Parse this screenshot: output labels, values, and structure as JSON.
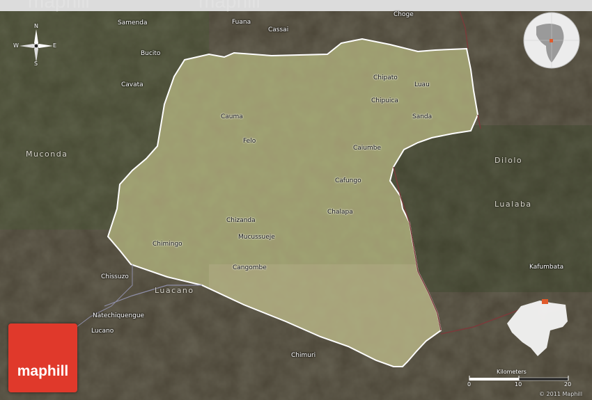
{
  "watermarks": [
    "maphill",
    "maphill"
  ],
  "logo_text": "maphill",
  "colors": {
    "accent": "#e0392b",
    "highlight": "#e05a2b",
    "border": "#ffffff"
  },
  "compass": {
    "n": "N",
    "s": "S",
    "e": "E",
    "w": "W"
  },
  "places": [
    {
      "name": "Samenda",
      "inner": false
    },
    {
      "name": "Fuana",
      "inner": false
    },
    {
      "name": "Cassai",
      "inner": false
    },
    {
      "name": "Choge",
      "inner": false
    },
    {
      "name": "Bucito",
      "inner": false
    },
    {
      "name": "Cavata",
      "inner": false
    },
    {
      "name": "Chipato",
      "inner": true
    },
    {
      "name": "Luau",
      "inner": true
    },
    {
      "name": "Chipuica",
      "inner": true
    },
    {
      "name": "Sanda",
      "inner": true
    },
    {
      "name": "Cauma",
      "inner": true
    },
    {
      "name": "Felo",
      "inner": true
    },
    {
      "name": "Caiumbe",
      "inner": true
    },
    {
      "name": "Cafungo",
      "inner": true
    },
    {
      "name": "Chalapa",
      "inner": true
    },
    {
      "name": "Chizanda",
      "inner": true
    },
    {
      "name": "Mucussueje",
      "inner": true
    },
    {
      "name": "Chimingo",
      "inner": true
    },
    {
      "name": "Cangombe",
      "inner": true
    },
    {
      "name": "Chissuzo",
      "inner": false
    },
    {
      "name": "Natechiquengue",
      "inner": false
    },
    {
      "name": "Lucano",
      "inner": false
    },
    {
      "name": "Chimuri",
      "inner": false
    },
    {
      "name": "Kafumbata",
      "inner": false
    }
  ],
  "regions": [
    "Muconda",
    "Dilolo",
    "Lualaba",
    "Luacano"
  ],
  "scale": {
    "title": "Kilometers",
    "ticks": [
      "0",
      "10",
      "20"
    ]
  },
  "copyright": "© 2011 Maphill"
}
